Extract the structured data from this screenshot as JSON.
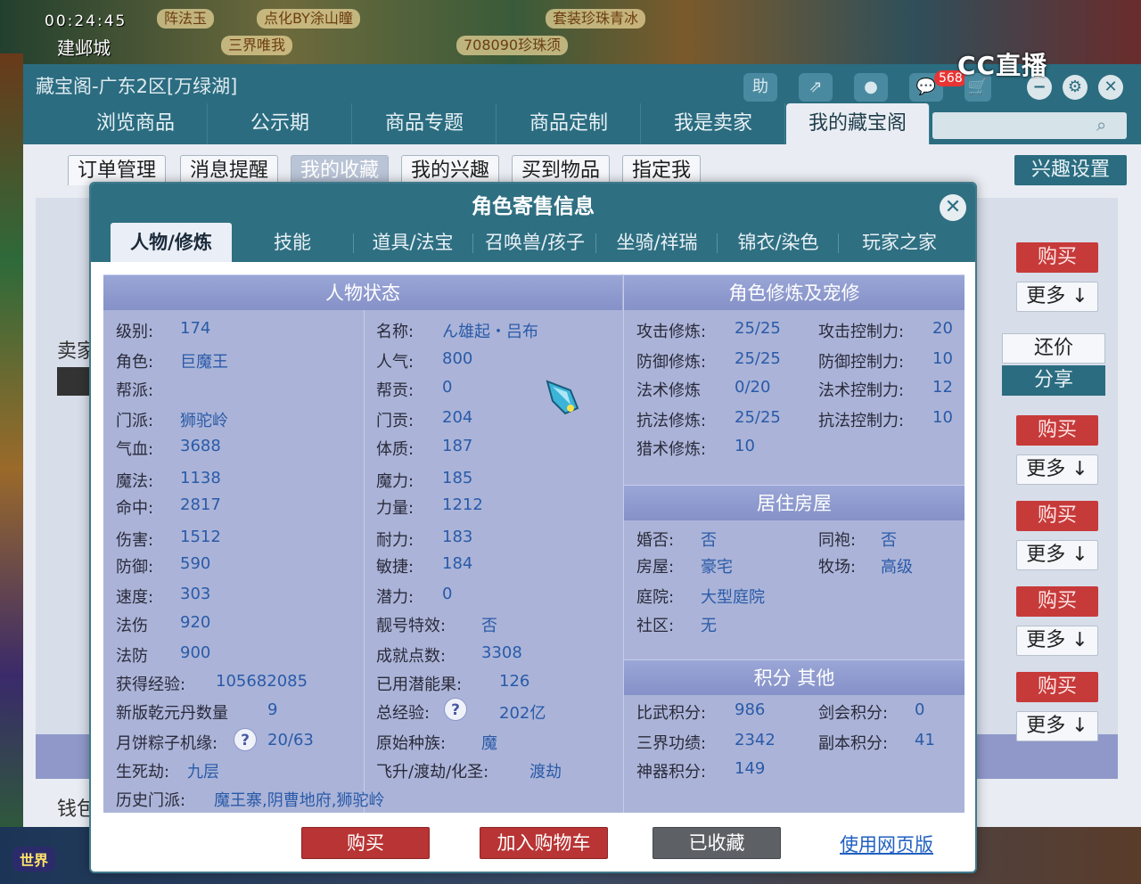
{
  "game": {
    "clock": "00:24:45",
    "city": "建邺城",
    "chips": [
      "阵法玉",
      "点化BY涂山瞳",
      "套装珍珠青冰",
      "708090珍珠须",
      "三界唯我"
    ],
    "world_label": "世界",
    "stream_logo": "CC直播"
  },
  "cbg": {
    "title": "藏宝阁-广东2区[万绿湖]",
    "toolbar": {
      "help": "助",
      "share": "⇗",
      "record": "●",
      "chat": "💬",
      "badge": "568",
      "cart": "🛒"
    },
    "window_controls": {
      "minimize": "−",
      "settings": "⚙",
      "close": "✕"
    },
    "nav": [
      "浏览商品",
      "公示期",
      "商品专题",
      "商品定制",
      "我是卖家",
      "我的藏宝阁"
    ],
    "nav_active": 5,
    "search_placeholder": "",
    "subnav": [
      "订单管理",
      "消息提醒",
      "我的收藏",
      "我的兴趣",
      "买到物品",
      "指定我"
    ],
    "subnav_active": 2,
    "interest_settings": "兴趣设置",
    "seller_label": "卖家",
    "money_label": "钱包",
    "buy": "购买",
    "more": "更多 ↓",
    "bargain": "还价",
    "share": "分享"
  },
  "modal": {
    "title": "角色寄售信息",
    "close": "✕",
    "tabs": [
      "人物/修炼",
      "技能",
      "道具/法宝",
      "召唤兽/孩子",
      "坐骑/祥瑞",
      "锦衣/染色",
      "玩家之家"
    ],
    "active_tab": 0,
    "status_header": "人物状态",
    "status_left": [
      {
        "k": "级别:",
        "v": "174"
      },
      {
        "k": "角色:",
        "v": "巨魔王"
      },
      {
        "k": "帮派:",
        "v": ""
      },
      {
        "k": "门派:",
        "v": "狮驼岭"
      },
      {
        "k": "气血:",
        "v": "3688"
      },
      {
        "k": "魔法:",
        "v": "1138"
      },
      {
        "k": "命中:",
        "v": "2817"
      },
      {
        "k": "伤害:",
        "v": "1512"
      },
      {
        "k": "防御:",
        "v": "590"
      },
      {
        "k": "速度:",
        "v": "303"
      },
      {
        "k": "法伤",
        "v": "920"
      },
      {
        "k": "法防",
        "v": "900"
      },
      {
        "k": "获得经验:",
        "v": "105682085"
      },
      {
        "k": "新版乾元丹数量",
        "v": "9"
      },
      {
        "k": "月饼粽子机缘:",
        "v": "20/63"
      },
      {
        "k": "生死劫:",
        "v": "九层"
      },
      {
        "k": "历史门派:",
        "v": "魔王寨,阴曹地府,狮驼岭"
      }
    ],
    "status_right": [
      {
        "k": "名称:",
        "v": "ん雄起・吕布"
      },
      {
        "k": "人气:",
        "v": "800"
      },
      {
        "k": "帮贡:",
        "v": "0"
      },
      {
        "k": "门贡:",
        "v": "204"
      },
      {
        "k": "体质:",
        "v": "187"
      },
      {
        "k": "魔力:",
        "v": "185"
      },
      {
        "k": "力量:",
        "v": "1212"
      },
      {
        "k": "耐力:",
        "v": "183"
      },
      {
        "k": "敏捷:",
        "v": "184"
      },
      {
        "k": "潜力:",
        "v": "0"
      },
      {
        "k": "靓号特效:",
        "v": "否"
      },
      {
        "k": "成就点数:",
        "v": "3308"
      },
      {
        "k": "已用潜能果:",
        "v": "126"
      },
      {
        "k": "总经验:",
        "v": "202亿"
      },
      {
        "k": "原始种族:",
        "v": "魔"
      },
      {
        "k": "飞升/渡劫/化圣:",
        "v": "渡劫"
      }
    ],
    "cultivation_header": "角色修炼及宠修",
    "cultivation": [
      {
        "k": "攻击修炼:",
        "v": "25/25",
        "k2": "攻击控制力:",
        "v2": "20"
      },
      {
        "k": "防御修炼:",
        "v": "25/25",
        "k2": "防御控制力:",
        "v2": "10"
      },
      {
        "k": "法术修炼",
        "v": "0/20",
        "k2": "法术控制力:",
        "v2": "12"
      },
      {
        "k": "抗法修炼:",
        "v": "25/25",
        "k2": "抗法控制力:",
        "v2": "10"
      },
      {
        "k": "猎术修炼:",
        "v": "10",
        "k2": "",
        "v2": ""
      }
    ],
    "house_header": "居住房屋",
    "house": [
      {
        "k": "婚否:",
        "v": "否",
        "k2": "同袍:",
        "v2": "否"
      },
      {
        "k": "房屋:",
        "v": "豪宅",
        "k2": "牧场:",
        "v2": "高级"
      },
      {
        "k": "庭院:",
        "v": "大型庭院",
        "k2": "",
        "v2": ""
      },
      {
        "k": "社区:",
        "v": "无",
        "k2": "",
        "v2": ""
      }
    ],
    "points_header": "积分 其他",
    "points": [
      {
        "k": "比武积分:",
        "v": "986",
        "k2": "剑会积分:",
        "v2": "0"
      },
      {
        "k": "三界功绩:",
        "v": "2342",
        "k2": "副本积分:",
        "v2": "41"
      },
      {
        "k": "神器积分:",
        "v": "149",
        "k2": "",
        "v2": ""
      }
    ],
    "help_glyph": "?",
    "buttons": {
      "buy": "购买",
      "cart": "加入购物车",
      "favorited": "已收藏",
      "web": "使用网页版"
    }
  },
  "colors": {
    "accent": "#2b6c80",
    "buy_red": "#c73a3a",
    "panel": "#abb4d8",
    "value_blue": "#2a5aa8"
  }
}
